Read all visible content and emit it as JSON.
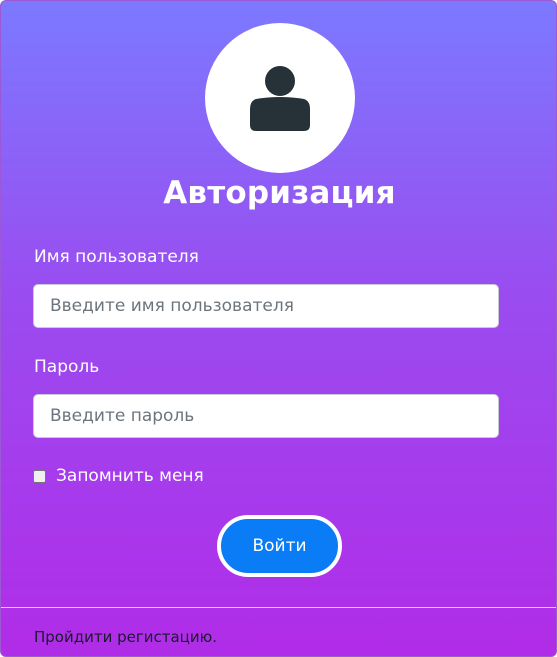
{
  "form": {
    "title": "Авторизация",
    "username": {
      "label": "Имя пользователя",
      "placeholder": "Введите имя пользователя",
      "value": ""
    },
    "password": {
      "label": "Пароль",
      "placeholder": "Введите пароль",
      "value": ""
    },
    "remember": {
      "label": "Запомнить меня",
      "checked": false
    },
    "submit_label": "Войти",
    "register_link": "Пройдити регистацию."
  },
  "icons": {
    "avatar": "user-icon"
  },
  "colors": {
    "gradient_top": "#7c79ff",
    "gradient_bottom": "#b12ce8",
    "button": "#0a7cf5",
    "icon": "#263238"
  }
}
